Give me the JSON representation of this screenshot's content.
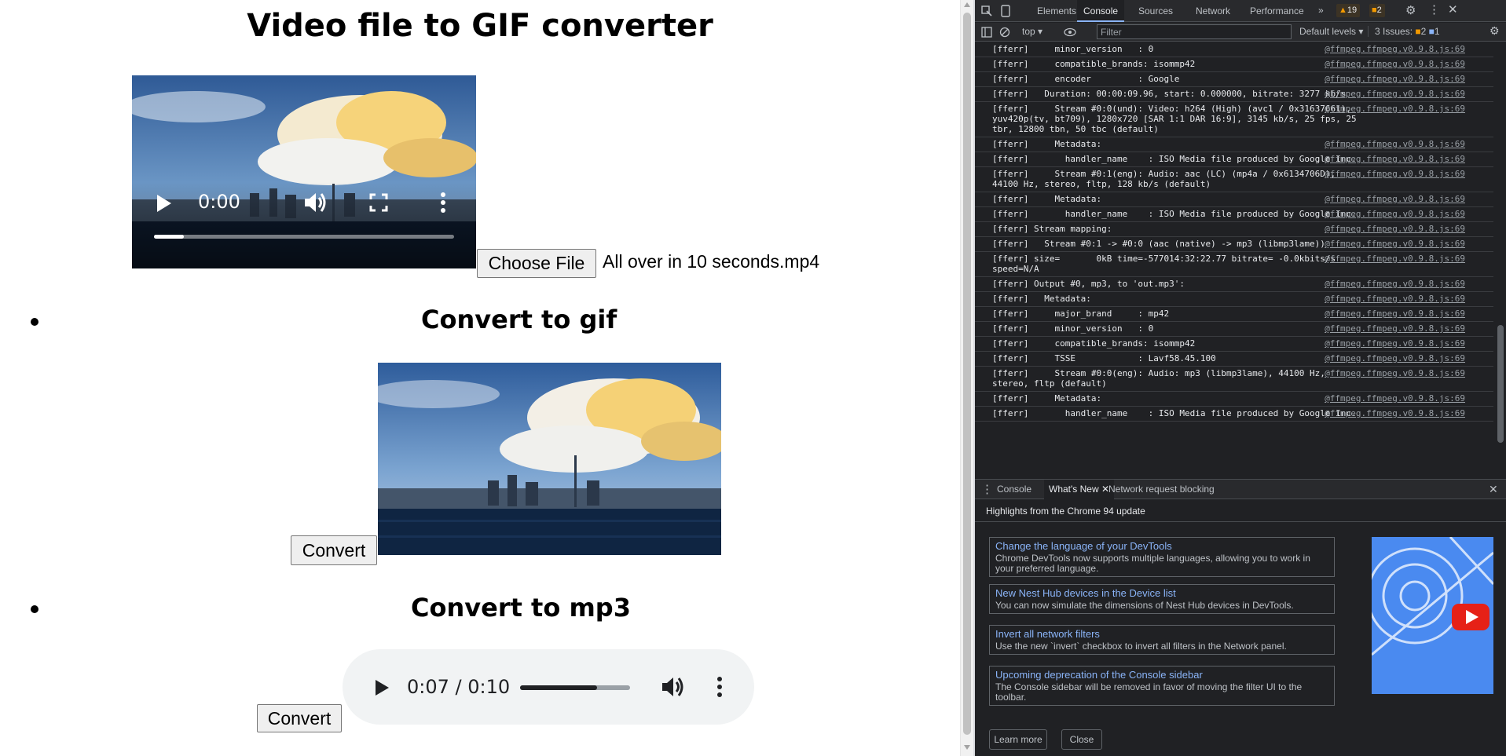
{
  "page": {
    "title": "Video file to GIF converter",
    "video": {
      "time": "0:00",
      "progress": 0.1
    },
    "choose_file_label": "Choose File",
    "file_name": "All over in 10 seconds.mp4",
    "gif_section": {
      "heading": "Convert to gif",
      "button": "Convert"
    },
    "mp3_section": {
      "heading": "Convert to mp3",
      "button": "Convert",
      "audio_time": "0:07 / 0:10",
      "audio_progress": 0.7
    }
  },
  "devtools": {
    "tabs": [
      "Elements",
      "Console",
      "Sources",
      "Network",
      "Performance"
    ],
    "active_tab": "Console",
    "warnings_count": "19",
    "errors_count": "2",
    "context": "top",
    "filter_placeholder": "Filter",
    "levels": "Default levels",
    "issues_label": "3 Issues:",
    "issues_warn": "2",
    "issues_info": "1",
    "console_rows": [
      {
        "text": "[fferr]     minor_version   : 0",
        "src": "@ffmpeg.ffmpeg.v0.9.8.js:69"
      },
      {
        "text": "[fferr]     compatible_brands: isommp42",
        "src": "@ffmpeg.ffmpeg.v0.9.8.js:69"
      },
      {
        "text": "[fferr]     encoder         : Google",
        "src": "@ffmpeg.ffmpeg.v0.9.8.js:69"
      },
      {
        "text": "[fferr]   Duration: 00:00:09.96, start: 0.000000, bitrate: 3277 kb/s",
        "src": "@ffmpeg.ffmpeg.v0.9.8.js:69"
      },
      {
        "text": "[fferr]     Stream #0:0(und): Video: h264 (High) (avc1 / 0x31637661), yuv420p(tv, bt709), 1280x720 [SAR 1:1 DAR 16:9], 3145 kb/s, 25 fps, 25 tbr, 12800 tbn, 50 tbc (default)",
        "src": "@ffmpeg.ffmpeg.v0.9.8.js:69"
      },
      {
        "text": "[fferr]     Metadata:",
        "src": "@ffmpeg.ffmpeg.v0.9.8.js:69"
      },
      {
        "text": "[fferr]       handler_name    : ISO Media file produced by Google Inc.",
        "src": "@ffmpeg.ffmpeg.v0.9.8.js:69"
      },
      {
        "text": "[fferr]     Stream #0:1(eng): Audio: aac (LC) (mp4a / 0x6134706D), 44100 Hz, stereo, fltp, 128 kb/s (default)",
        "src": "@ffmpeg.ffmpeg.v0.9.8.js:69"
      },
      {
        "text": "[fferr]     Metadata:",
        "src": "@ffmpeg.ffmpeg.v0.9.8.js:69"
      },
      {
        "text": "[fferr]       handler_name    : ISO Media file produced by Google Inc.",
        "src": "@ffmpeg.ffmpeg.v0.9.8.js:69"
      },
      {
        "text": "[fferr] Stream mapping:",
        "src": "@ffmpeg.ffmpeg.v0.9.8.js:69"
      },
      {
        "text": "[fferr]   Stream #0:1 -> #0:0 (aac (native) -> mp3 (libmp3lame))",
        "src": "@ffmpeg.ffmpeg.v0.9.8.js:69"
      },
      {
        "text": "[fferr] size=       0kB time=-577014:32:22.77 bitrate= -0.0kbits/s speed=N/A",
        "src": "@ffmpeg.ffmpeg.v0.9.8.js:69"
      },
      {
        "text": "[fferr] Output #0, mp3, to 'out.mp3':",
        "src": "@ffmpeg.ffmpeg.v0.9.8.js:69"
      },
      {
        "text": "[fferr]   Metadata:",
        "src": "@ffmpeg.ffmpeg.v0.9.8.js:69"
      },
      {
        "text": "[fferr]     major_brand     : mp42",
        "src": "@ffmpeg.ffmpeg.v0.9.8.js:69"
      },
      {
        "text": "[fferr]     minor_version   : 0",
        "src": "@ffmpeg.ffmpeg.v0.9.8.js:69"
      },
      {
        "text": "[fferr]     compatible_brands: isommp42",
        "src": "@ffmpeg.ffmpeg.v0.9.8.js:69"
      },
      {
        "text": "[fferr]     TSSE            : Lavf58.45.100",
        "src": "@ffmpeg.ffmpeg.v0.9.8.js:69"
      },
      {
        "text": "[fferr]     Stream #0:0(eng): Audio: mp3 (libmp3lame), 44100 Hz, stereo, fltp (default)",
        "src": "@ffmpeg.ffmpeg.v0.9.8.js:69"
      },
      {
        "text": "[fferr]     Metadata:",
        "src": "@ffmpeg.ffmpeg.v0.9.8.js:69"
      },
      {
        "text": "[fferr]       handler_name    : ISO Media file produced by Google Inc.",
        "src": "@ffmpeg.ffmpeg.v0.9.8.js:69"
      }
    ],
    "drawer_tabs": [
      "Console",
      "What's New",
      "Network request blocking"
    ],
    "drawer_active": "What's New",
    "whatsnew_heading": "Highlights from the Chrome 94 update",
    "cards": [
      {
        "title": "Change the language of your DevTools",
        "desc": "Chrome DevTools now supports multiple languages, allowing you to work in your preferred language."
      },
      {
        "title": "New Nest Hub devices in the Device list",
        "desc": "You can now simulate the dimensions of Nest Hub devices in DevTools."
      },
      {
        "title": "Invert all network filters",
        "desc": "Use the new `invert` checkbox to invert all filters in the Network panel."
      },
      {
        "title": "Upcoming deprecation of the Console sidebar",
        "desc": "The Console sidebar will be removed in favor of moving the filter UI to the toolbar."
      }
    ],
    "learn_more": "Learn more",
    "close": "Close",
    "colors": {
      "bg": "#202124",
      "link": "#8ab4f8",
      "warn": "#f29900",
      "info": "#8ab4f8"
    }
  }
}
